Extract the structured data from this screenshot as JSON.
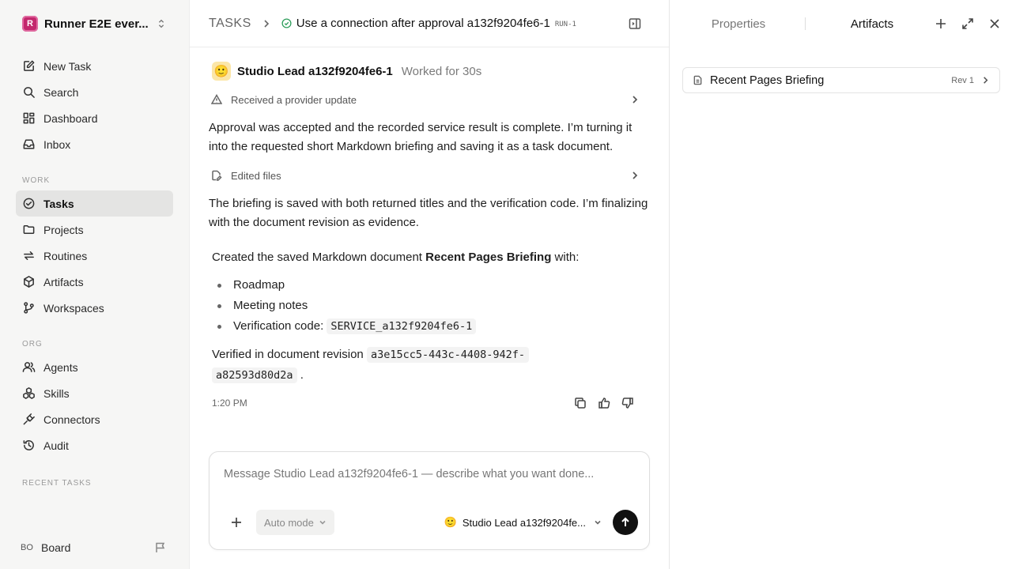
{
  "workspace": {
    "logo_letter": "R",
    "name": "Runner E2E ever..."
  },
  "sidebar": {
    "top_items": [
      {
        "label": "New Task",
        "icon": "new-task-icon"
      },
      {
        "label": "Search",
        "icon": "search-icon"
      },
      {
        "label": "Dashboard",
        "icon": "dashboard-icon"
      },
      {
        "label": "Inbox",
        "icon": "inbox-icon"
      }
    ],
    "work_label": "WORK",
    "work_items": [
      {
        "label": "Tasks",
        "icon": "tasks-icon",
        "active": true
      },
      {
        "label": "Projects",
        "icon": "folder-icon"
      },
      {
        "label": "Routines",
        "icon": "routines-icon"
      },
      {
        "label": "Artifacts",
        "icon": "cube-icon"
      },
      {
        "label": "Workspaces",
        "icon": "branch-icon"
      }
    ],
    "org_label": "ORG",
    "org_items": [
      {
        "label": "Agents",
        "icon": "users-icon"
      },
      {
        "label": "Skills",
        "icon": "skills-icon"
      },
      {
        "label": "Connectors",
        "icon": "plug-icon"
      },
      {
        "label": "Audit",
        "icon": "history-icon"
      }
    ],
    "recent_label": "RECENT TASKS",
    "footer": {
      "initials": "BO",
      "name": "Board"
    }
  },
  "header": {
    "root": "TASKS",
    "task_title": "Use a connection after approval a132f9204fe6-1",
    "run_tag": "RUN-1"
  },
  "thread": {
    "author_emoji": "🙂",
    "author": "Studio Lead a132f9204fe6-1",
    "worked": "Worked for 30s",
    "event1": "Received a provider update",
    "para1": "Approval was accepted and the recorded service result is complete. I’m turning it into the requested short Markdown briefing and saving it as a task document.",
    "event2": "Edited files",
    "para2": "The briefing is saved with both returned titles and the verification code. I’m finalizing with the document revision as evidence.",
    "summary_prefix": "Created the saved Markdown document ",
    "summary_doc": "Recent Pages Briefing",
    "summary_suffix": " with:",
    "bullets": [
      "Roadmap",
      "Meeting notes"
    ],
    "verification_label": "Verification code: ",
    "verification_code": "SERVICE_a132f9204fe6-1",
    "revision_prefix": "Verified in document revision ",
    "revision_part1": "a3e15cc5-443c-4408-942f-",
    "revision_part2": "a82593d80d2a",
    "revision_suffix": ".",
    "time": "1:20 PM"
  },
  "composer": {
    "placeholder": "Message Studio Lead a132f9204fe6-1 — describe what you want done...",
    "mode": "Auto mode",
    "agent": "Studio Lead a132f9204fe..."
  },
  "right_panel": {
    "tabs": [
      "Properties",
      "Artifacts"
    ],
    "active_tab": "Artifacts",
    "artifact": {
      "name": "Recent Pages Briefing",
      "rev": "Rev 1"
    }
  },
  "colors": {
    "accent_logo": "#c3286d",
    "status_green": "#2e9d5b",
    "send_button": "#111111"
  }
}
